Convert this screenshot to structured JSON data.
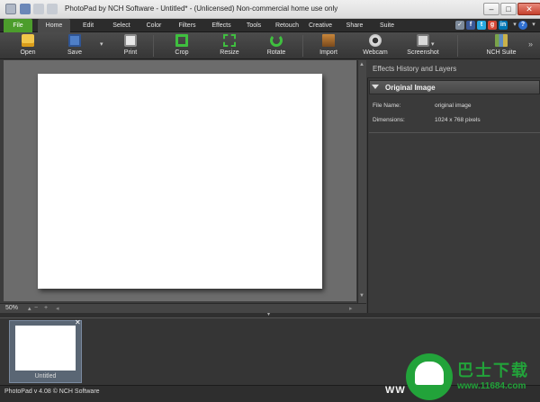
{
  "window": {
    "title": "PhotoPad by NCH Software - Untitled* - (Unlicensed) Non-commercial home use only",
    "minimize": "–",
    "maximize": "□",
    "close": "✕"
  },
  "menu": {
    "tabs": [
      "File",
      "Home",
      "Edit",
      "Select",
      "Color",
      "Filters",
      "Effects",
      "Tools",
      "Retouch",
      "Creative",
      "Share",
      "Suite"
    ],
    "active": "Home",
    "help": "?"
  },
  "toolbar": {
    "buttons": [
      {
        "label": "Open",
        "icon": "open-folder-icon"
      },
      {
        "label": "Save",
        "icon": "save-disk-icon"
      },
      {
        "label": "Print",
        "icon": "printer-icon"
      },
      {
        "label": "Crop",
        "icon": "crop-icon"
      },
      {
        "label": "Resize",
        "icon": "resize-icon"
      },
      {
        "label": "Rotate",
        "icon": "rotate-icon"
      },
      {
        "label": "Import",
        "icon": "import-icon"
      },
      {
        "label": "Webcam",
        "icon": "webcam-icon"
      },
      {
        "label": "Screenshot",
        "icon": "screenshot-icon"
      },
      {
        "label": "NCH Suite",
        "icon": "nch-suite-icon"
      }
    ],
    "overflow": "»"
  },
  "canvas": {
    "zoom": "50%"
  },
  "panel": {
    "header": "Effects History and Layers",
    "section": "Original Image",
    "properties": [
      {
        "key": "File Name:",
        "value": "original image"
      },
      {
        "key": "Dimensions:",
        "value": "1024 x 768 pixels"
      }
    ]
  },
  "thumbnails": [
    {
      "label": "Untitled",
      "close": "✕"
    }
  ],
  "status": {
    "text": "PhotoPad v 4.08 © NCH Software"
  },
  "watermark": {
    "site_cn": "巴士下载",
    "url": "www.11684.com",
    "www": "WW"
  },
  "colors": {
    "file_tab": "#4c9d2c",
    "accent_green": "#22a33a",
    "toolbar_icon": "#3fbf3f"
  }
}
